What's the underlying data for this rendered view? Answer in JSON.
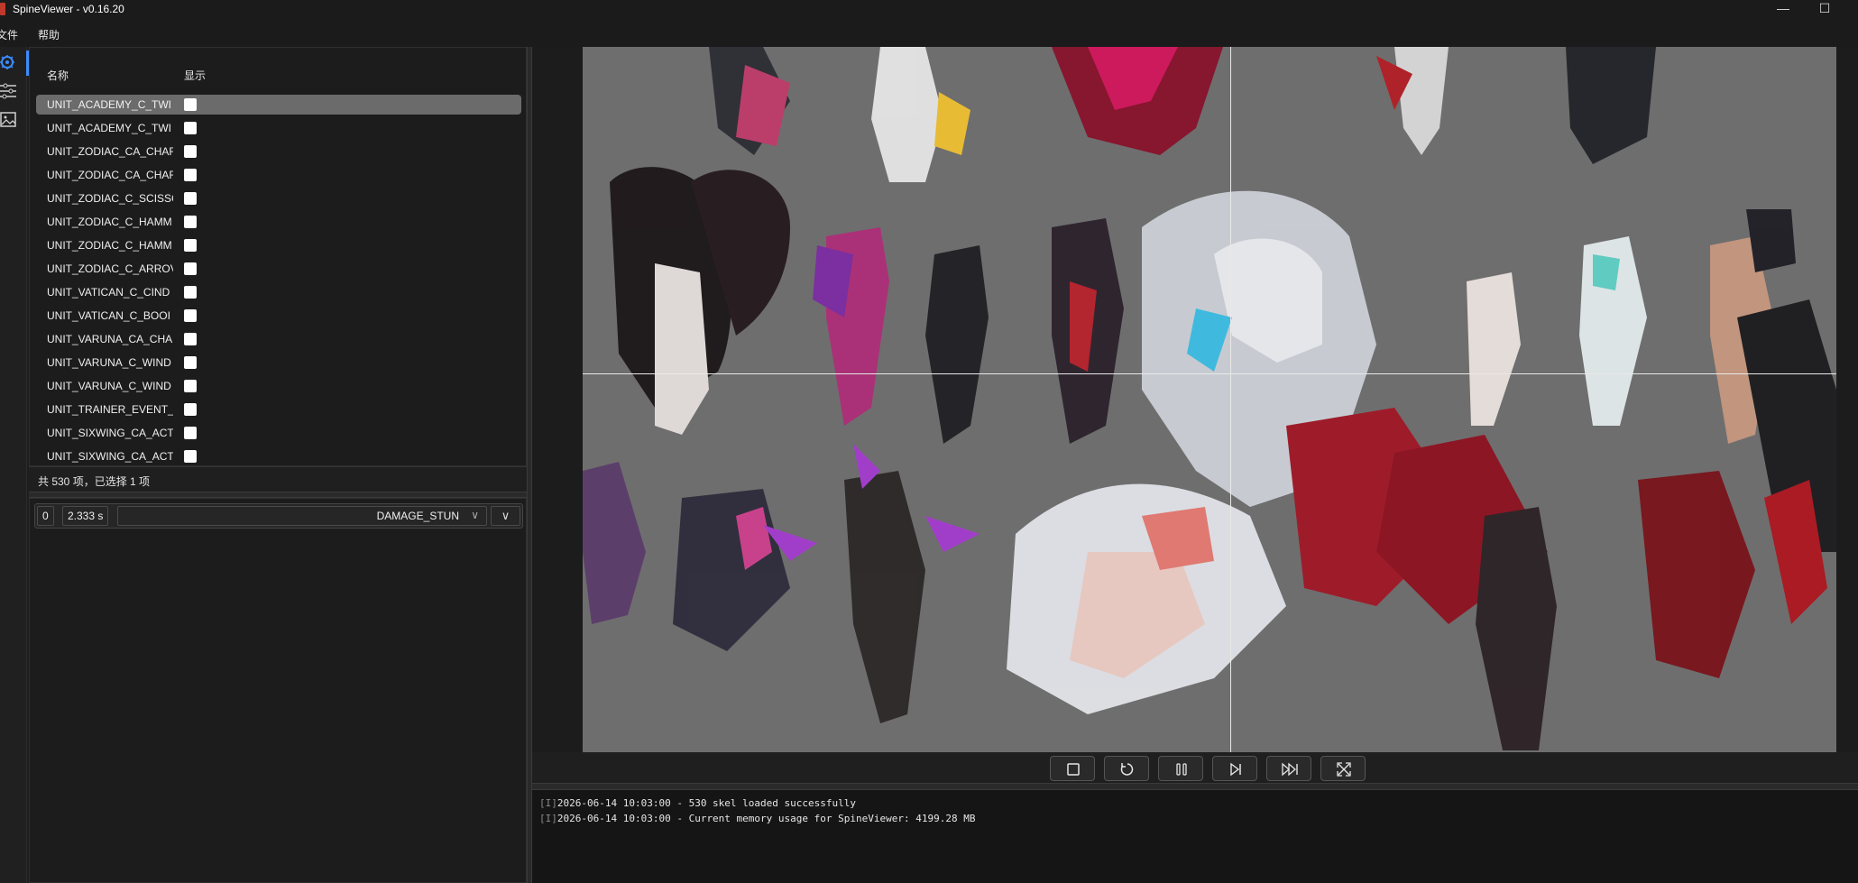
{
  "window": {
    "title": "SpineViewer - v0.16.20",
    "minimize_glyph": "—",
    "maximize_glyph": "☐"
  },
  "menu": {
    "items": [
      {
        "label": "文件"
      },
      {
        "label": "帮助"
      }
    ]
  },
  "rail": {
    "icons": [
      "settings-cog-icon",
      "sliders-icon",
      "image-icon"
    ]
  },
  "list": {
    "columns": {
      "name": "名称",
      "show": "显示"
    },
    "rows": [
      {
        "name": "UNIT_ACADEMY_C_TWI",
        "show": false,
        "selected": true
      },
      {
        "name": "UNIT_ACADEMY_C_TWI",
        "show": false,
        "selected": false
      },
      {
        "name": "UNIT_ZODIAC_CA_CHAF",
        "show": false,
        "selected": false
      },
      {
        "name": "UNIT_ZODIAC_CA_CHAF",
        "show": false,
        "selected": false
      },
      {
        "name": "UNIT_ZODIAC_C_SCISSC",
        "show": false,
        "selected": false
      },
      {
        "name": "UNIT_ZODIAC_C_HAMM",
        "show": false,
        "selected": false
      },
      {
        "name": "UNIT_ZODIAC_C_HAMM",
        "show": false,
        "selected": false
      },
      {
        "name": "UNIT_ZODIAC_C_ARROV",
        "show": false,
        "selected": false
      },
      {
        "name": "UNIT_VATICAN_C_CIND",
        "show": false,
        "selected": false
      },
      {
        "name": "UNIT_VATICAN_C_BOOI",
        "show": false,
        "selected": false
      },
      {
        "name": "UNIT_VARUNA_CA_CHA",
        "show": false,
        "selected": false
      },
      {
        "name": "UNIT_VARUNA_C_WIND",
        "show": false,
        "selected": false
      },
      {
        "name": "UNIT_VARUNA_C_WIND",
        "show": false,
        "selected": false
      },
      {
        "name": "UNIT_TRAINER_EVENT_I",
        "show": false,
        "selected": false
      },
      {
        "name": "UNIT_SIXWING_CA_ACT",
        "show": false,
        "selected": false
      },
      {
        "name": "UNIT_SIXWING_CA_ACT",
        "show": false,
        "selected": false
      }
    ],
    "status": "共 530 项，已选择 1 项"
  },
  "animation": {
    "track": "0",
    "duration": "2.333 s",
    "name": "DAMAGE_STUN",
    "arrow": "∨",
    "expand": "∨"
  },
  "controls": {
    "buttons": [
      "stop",
      "restart",
      "pause",
      "step-forward",
      "skip-to-end",
      "fullscreen"
    ]
  },
  "log": {
    "lines": [
      {
        "prefix": "[I]",
        "text": "2026-06-14 10:03:00 - 530 skel loaded successfully"
      },
      {
        "prefix": "[I]",
        "text": "2026-06-14 10:03:00 - Current memory usage for SpineViewer: 4199.28 MB"
      }
    ]
  },
  "colors": {
    "accent": "#3d8bfd",
    "canvas_bg": "#6e6e6e",
    "selected_row": "#6b6b6b"
  }
}
